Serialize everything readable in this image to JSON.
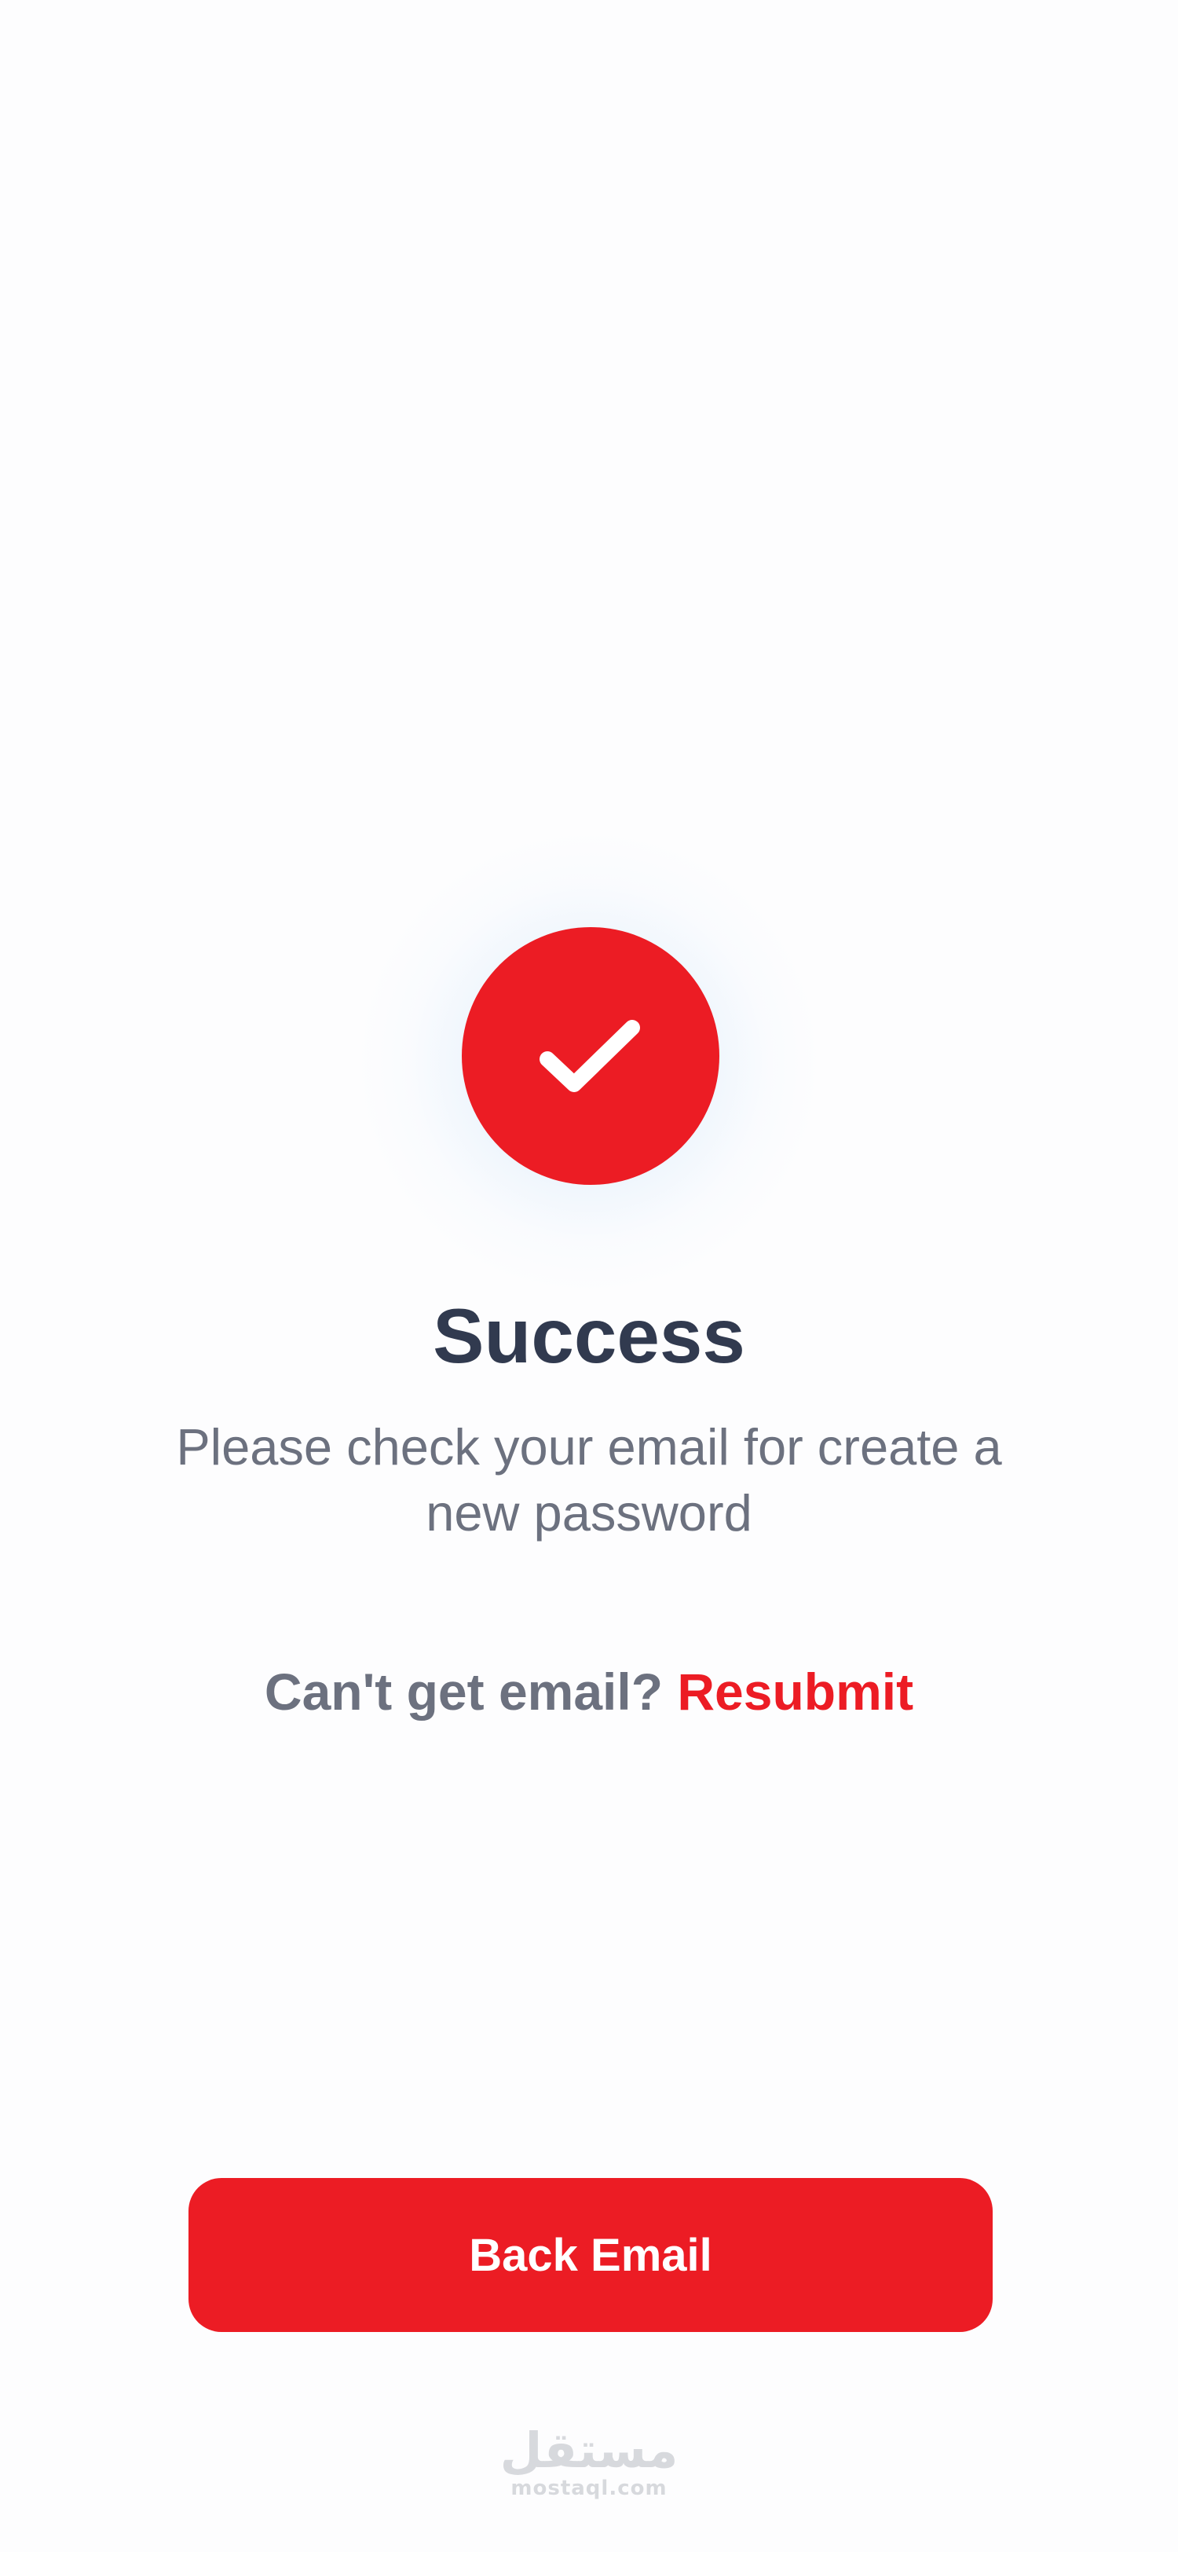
{
  "status": {
    "icon": "checkmark-icon",
    "title": "Success",
    "message": "Please check your email for create a new password"
  },
  "resubmit": {
    "prompt": "Can't get email?",
    "link_label": "Resubmit"
  },
  "actions": {
    "back_email_label": "Back Email"
  },
  "watermark": {
    "logo_text": "مستقل",
    "domain": "mostaql.com"
  },
  "colors": {
    "accent": "#ec1c24",
    "title": "#313a4f",
    "body_text": "#6c717f",
    "background": "#fdfdfe"
  }
}
